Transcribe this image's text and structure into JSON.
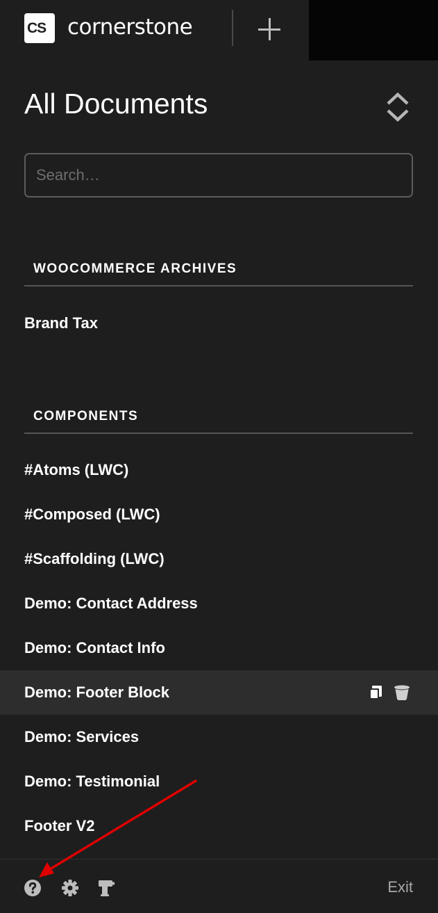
{
  "app": {
    "logo_text": "CS",
    "name": "cornerstone"
  },
  "header": {
    "title": "All Documents"
  },
  "search": {
    "placeholder": "Search…",
    "value": ""
  },
  "sections": [
    {
      "title": "WOOCOMMERCE ARCHIVES",
      "items": [
        "Brand Tax"
      ]
    },
    {
      "title": "COMPONENTS",
      "items": [
        "#Atoms (LWC)",
        "#Composed (LWC)",
        "#Scaffolding (LWC)",
        "Demo: Contact Address",
        "Demo: Contact Info",
        "Demo: Footer Block",
        "Demo: Services",
        "Demo: Testimonial",
        "Footer V2"
      ]
    }
  ],
  "hovered_item": "Demo: Footer Block",
  "footer": {
    "exit_label": "Exit"
  },
  "icons": {
    "add": "plus-icon",
    "sort": "chevron-up-down-icon",
    "duplicate": "copy-icon",
    "delete": "trash-icon",
    "help": "question-circle-icon",
    "settings": "gear-icon",
    "tools": "drill-icon"
  },
  "colors": {
    "background": "#1e1e1e",
    "hover_row": "#2d2d2d",
    "text": "#ffffff",
    "muted": "#a8a8a8",
    "annotation_arrow": "#e00000"
  }
}
